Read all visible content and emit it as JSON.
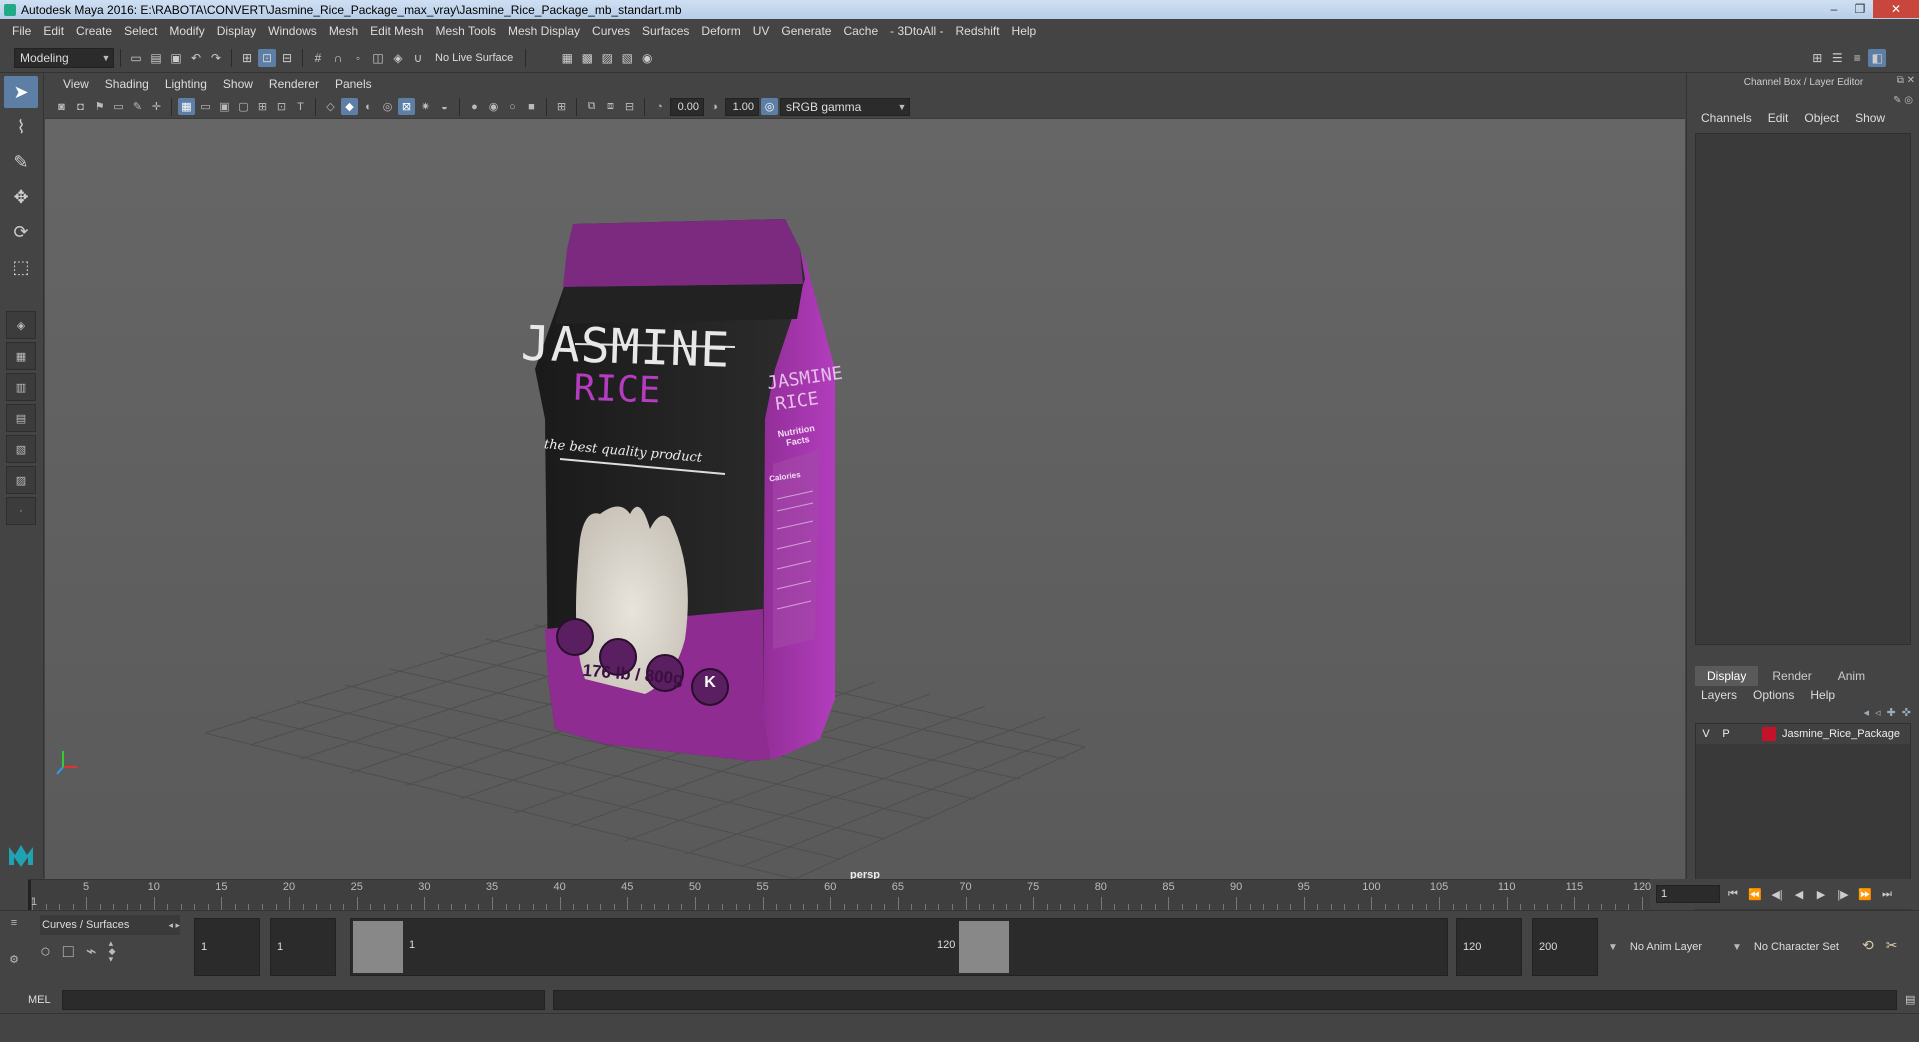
{
  "title_bar": {
    "title": "Autodesk Maya 2016: E:\\RABOTA\\CONVERT\\Jasmine_Rice_Package_max_vray\\Jasmine_Rice_Package_mb_standart.mb",
    "minimize": "–",
    "maximize": "❐",
    "close": "✕"
  },
  "main_menu": [
    "File",
    "Edit",
    "Create",
    "Select",
    "Modify",
    "Display",
    "Windows",
    "Mesh",
    "Edit Mesh",
    "Mesh Tools",
    "Mesh Display",
    "Curves",
    "Surfaces",
    "Deform",
    "UV",
    "Generate",
    "Cache",
    "- 3DtoAll -",
    "Redshift",
    "Help"
  ],
  "status_line": {
    "mode": "Modeling",
    "live_surface": "No Live Surface"
  },
  "viewport": {
    "menu": [
      "View",
      "Shading",
      "Lighting",
      "Show",
      "Renderer",
      "Panels"
    ],
    "exposure": "0.00",
    "gamma": "1.00",
    "color_space": "sRGB gamma",
    "camera_label": "persp"
  },
  "package": {
    "brand_line1": "JASMINE",
    "brand_line2": "RICE",
    "tagline": "the best quality product",
    "weight": "176 lb / 800g",
    "side_brand1": "JASMINE",
    "side_brand2": "RICE",
    "nutrition_title": "Nutrition Facts",
    "calories": "Calories",
    "kosher_mark": "K"
  },
  "channel_box": {
    "header": "Channel Box / Layer Editor",
    "menu": [
      "Channels",
      "Edit",
      "Object",
      "Show"
    ]
  },
  "layer_editor": {
    "tabs": [
      "Display",
      "Render",
      "Anim"
    ],
    "menu": [
      "Layers",
      "Options",
      "Help"
    ],
    "layers": [
      {
        "v": "V",
        "p": "P",
        "color": "#c4122a",
        "name": "Jasmine_Rice_Package"
      }
    ]
  },
  "timeline": {
    "ticks": [
      1,
      5,
      10,
      15,
      20,
      25,
      30,
      35,
      40,
      45,
      50,
      55,
      60,
      65,
      70,
      75,
      80,
      85,
      90,
      95,
      100,
      105,
      110,
      115,
      120
    ],
    "current_frame": "1"
  },
  "range": {
    "shelf_tab": "Curves / Surfaces",
    "start": "1",
    "playback_start": "1",
    "slider_start": "1",
    "slider_end": "120",
    "playback_end": "120",
    "end": "200",
    "anim_layer": "No Anim Layer",
    "character_set": "No Character Set"
  },
  "command_line": {
    "label": "MEL"
  }
}
